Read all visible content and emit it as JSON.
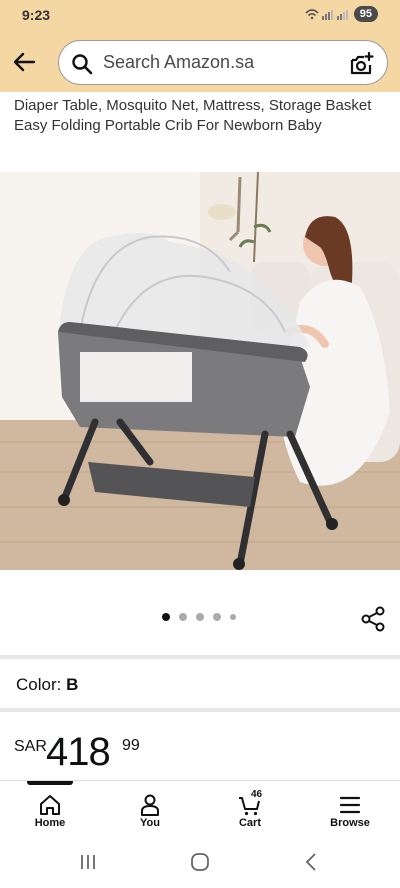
{
  "status": {
    "time": "9:23",
    "battery": "95"
  },
  "search": {
    "placeholder": "Search Amazon.sa"
  },
  "product": {
    "title": "Diaper Table, Mosquito Net, Mattress, Storage Basket Easy Folding Portable Crib For Newborn Baby",
    "image_icon": "crib-photo",
    "carousel_count": 5,
    "carousel_active": 1,
    "color_label": "Color:",
    "color_value": "B",
    "price": {
      "currency": "SAR",
      "whole": "418",
      "fraction": "99"
    }
  },
  "bottom_nav": {
    "items": [
      {
        "label": "Home",
        "icon": "home-icon"
      },
      {
        "label": "You",
        "icon": "person-icon"
      },
      {
        "label": "Cart",
        "icon": "cart-icon"
      },
      {
        "label": "Browse",
        "icon": "menu-icon"
      }
    ],
    "cart_count": "46"
  },
  "colors": {
    "header_bg": "#f5d7a3",
    "text": "#0f1111"
  }
}
